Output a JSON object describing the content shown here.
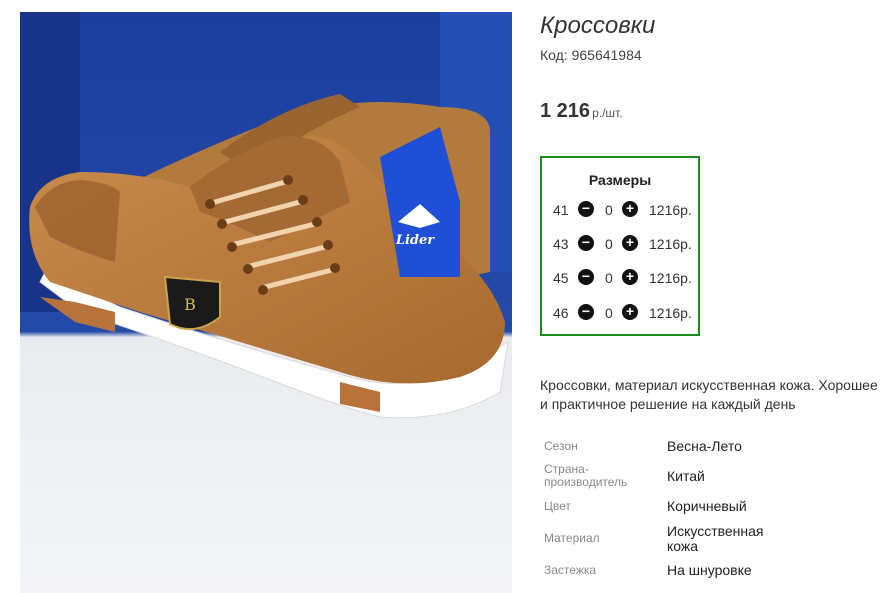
{
  "product": {
    "title": "Кроссовки",
    "code": "Код: 965641984",
    "price": "1 216",
    "price_unit": "р./шт."
  },
  "photo": {
    "tag_brand": "Lider",
    "badge_letter": "B"
  },
  "sizes": {
    "title": "Размеры",
    "rows": [
      {
        "size": "41",
        "qty": "0",
        "price": "1216р."
      },
      {
        "size": "43",
        "qty": "0",
        "price": "1216р."
      },
      {
        "size": "45",
        "qty": "0",
        "price": "1216р."
      },
      {
        "size": "46",
        "qty": "0",
        "price": "1216р."
      }
    ]
  },
  "description": "Кроссовки, материал искусственная кожа. Хорошее и практичное решение на каждый день",
  "specs": [
    {
      "label": "Сезон",
      "value": "Весна-Лето"
    },
    {
      "label": "Страна-производитель",
      "value": "Китай"
    },
    {
      "label": "Цвет",
      "value": "Коричневый"
    },
    {
      "label": "Материал",
      "value": "Искусственная кожа"
    },
    {
      "label": "Застежка",
      "value": "На шнуровке"
    }
  ],
  "colors": {
    "sizes_border": "#1d8a1d",
    "box_blue": "#1c3f9e",
    "leather": "#b57a3d"
  }
}
